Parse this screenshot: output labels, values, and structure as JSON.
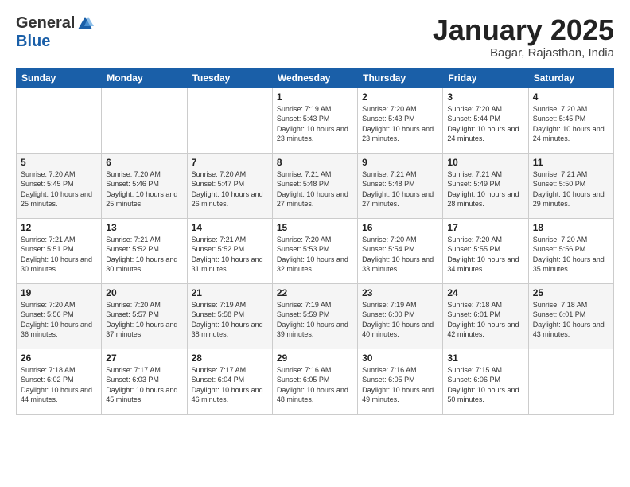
{
  "header": {
    "logo_general": "General",
    "logo_blue": "Blue",
    "month_title": "January 2025",
    "location": "Bagar, Rajasthan, India"
  },
  "weekdays": [
    "Sunday",
    "Monday",
    "Tuesday",
    "Wednesday",
    "Thursday",
    "Friday",
    "Saturday"
  ],
  "weeks": [
    [
      {
        "day": "",
        "sunrise": "",
        "sunset": "",
        "daylight": ""
      },
      {
        "day": "",
        "sunrise": "",
        "sunset": "",
        "daylight": ""
      },
      {
        "day": "",
        "sunrise": "",
        "sunset": "",
        "daylight": ""
      },
      {
        "day": "1",
        "sunrise": "Sunrise: 7:19 AM",
        "sunset": "Sunset: 5:43 PM",
        "daylight": "Daylight: 10 hours and 23 minutes."
      },
      {
        "day": "2",
        "sunrise": "Sunrise: 7:20 AM",
        "sunset": "Sunset: 5:43 PM",
        "daylight": "Daylight: 10 hours and 23 minutes."
      },
      {
        "day": "3",
        "sunrise": "Sunrise: 7:20 AM",
        "sunset": "Sunset: 5:44 PM",
        "daylight": "Daylight: 10 hours and 24 minutes."
      },
      {
        "day": "4",
        "sunrise": "Sunrise: 7:20 AM",
        "sunset": "Sunset: 5:45 PM",
        "daylight": "Daylight: 10 hours and 24 minutes."
      }
    ],
    [
      {
        "day": "5",
        "sunrise": "Sunrise: 7:20 AM",
        "sunset": "Sunset: 5:45 PM",
        "daylight": "Daylight: 10 hours and 25 minutes."
      },
      {
        "day": "6",
        "sunrise": "Sunrise: 7:20 AM",
        "sunset": "Sunset: 5:46 PM",
        "daylight": "Daylight: 10 hours and 25 minutes."
      },
      {
        "day": "7",
        "sunrise": "Sunrise: 7:20 AM",
        "sunset": "Sunset: 5:47 PM",
        "daylight": "Daylight: 10 hours and 26 minutes."
      },
      {
        "day": "8",
        "sunrise": "Sunrise: 7:21 AM",
        "sunset": "Sunset: 5:48 PM",
        "daylight": "Daylight: 10 hours and 27 minutes."
      },
      {
        "day": "9",
        "sunrise": "Sunrise: 7:21 AM",
        "sunset": "Sunset: 5:48 PM",
        "daylight": "Daylight: 10 hours and 27 minutes."
      },
      {
        "day": "10",
        "sunrise": "Sunrise: 7:21 AM",
        "sunset": "Sunset: 5:49 PM",
        "daylight": "Daylight: 10 hours and 28 minutes."
      },
      {
        "day": "11",
        "sunrise": "Sunrise: 7:21 AM",
        "sunset": "Sunset: 5:50 PM",
        "daylight": "Daylight: 10 hours and 29 minutes."
      }
    ],
    [
      {
        "day": "12",
        "sunrise": "Sunrise: 7:21 AM",
        "sunset": "Sunset: 5:51 PM",
        "daylight": "Daylight: 10 hours and 30 minutes."
      },
      {
        "day": "13",
        "sunrise": "Sunrise: 7:21 AM",
        "sunset": "Sunset: 5:52 PM",
        "daylight": "Daylight: 10 hours and 30 minutes."
      },
      {
        "day": "14",
        "sunrise": "Sunrise: 7:21 AM",
        "sunset": "Sunset: 5:52 PM",
        "daylight": "Daylight: 10 hours and 31 minutes."
      },
      {
        "day": "15",
        "sunrise": "Sunrise: 7:20 AM",
        "sunset": "Sunset: 5:53 PM",
        "daylight": "Daylight: 10 hours and 32 minutes."
      },
      {
        "day": "16",
        "sunrise": "Sunrise: 7:20 AM",
        "sunset": "Sunset: 5:54 PM",
        "daylight": "Daylight: 10 hours and 33 minutes."
      },
      {
        "day": "17",
        "sunrise": "Sunrise: 7:20 AM",
        "sunset": "Sunset: 5:55 PM",
        "daylight": "Daylight: 10 hours and 34 minutes."
      },
      {
        "day": "18",
        "sunrise": "Sunrise: 7:20 AM",
        "sunset": "Sunset: 5:56 PM",
        "daylight": "Daylight: 10 hours and 35 minutes."
      }
    ],
    [
      {
        "day": "19",
        "sunrise": "Sunrise: 7:20 AM",
        "sunset": "Sunset: 5:56 PM",
        "daylight": "Daylight: 10 hours and 36 minutes."
      },
      {
        "day": "20",
        "sunrise": "Sunrise: 7:20 AM",
        "sunset": "Sunset: 5:57 PM",
        "daylight": "Daylight: 10 hours and 37 minutes."
      },
      {
        "day": "21",
        "sunrise": "Sunrise: 7:19 AM",
        "sunset": "Sunset: 5:58 PM",
        "daylight": "Daylight: 10 hours and 38 minutes."
      },
      {
        "day": "22",
        "sunrise": "Sunrise: 7:19 AM",
        "sunset": "Sunset: 5:59 PM",
        "daylight": "Daylight: 10 hours and 39 minutes."
      },
      {
        "day": "23",
        "sunrise": "Sunrise: 7:19 AM",
        "sunset": "Sunset: 6:00 PM",
        "daylight": "Daylight: 10 hours and 40 minutes."
      },
      {
        "day": "24",
        "sunrise": "Sunrise: 7:18 AM",
        "sunset": "Sunset: 6:01 PM",
        "daylight": "Daylight: 10 hours and 42 minutes."
      },
      {
        "day": "25",
        "sunrise": "Sunrise: 7:18 AM",
        "sunset": "Sunset: 6:01 PM",
        "daylight": "Daylight: 10 hours and 43 minutes."
      }
    ],
    [
      {
        "day": "26",
        "sunrise": "Sunrise: 7:18 AM",
        "sunset": "Sunset: 6:02 PM",
        "daylight": "Daylight: 10 hours and 44 minutes."
      },
      {
        "day": "27",
        "sunrise": "Sunrise: 7:17 AM",
        "sunset": "Sunset: 6:03 PM",
        "daylight": "Daylight: 10 hours and 45 minutes."
      },
      {
        "day": "28",
        "sunrise": "Sunrise: 7:17 AM",
        "sunset": "Sunset: 6:04 PM",
        "daylight": "Daylight: 10 hours and 46 minutes."
      },
      {
        "day": "29",
        "sunrise": "Sunrise: 7:16 AM",
        "sunset": "Sunset: 6:05 PM",
        "daylight": "Daylight: 10 hours and 48 minutes."
      },
      {
        "day": "30",
        "sunrise": "Sunrise: 7:16 AM",
        "sunset": "Sunset: 6:05 PM",
        "daylight": "Daylight: 10 hours and 49 minutes."
      },
      {
        "day": "31",
        "sunrise": "Sunrise: 7:15 AM",
        "sunset": "Sunset: 6:06 PM",
        "daylight": "Daylight: 10 hours and 50 minutes."
      },
      {
        "day": "",
        "sunrise": "",
        "sunset": "",
        "daylight": ""
      }
    ]
  ]
}
